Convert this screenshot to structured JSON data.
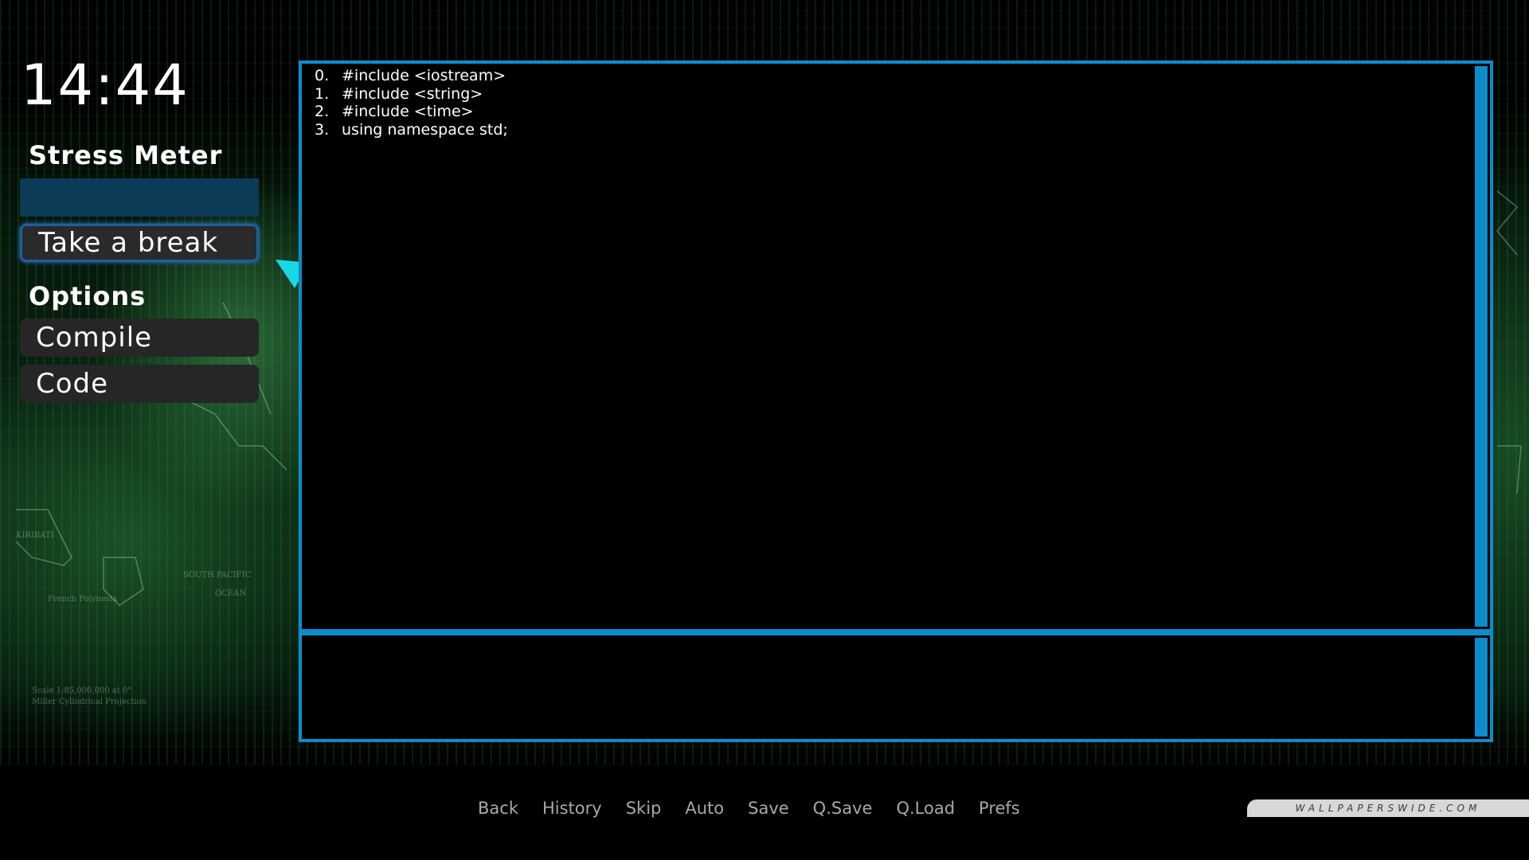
{
  "clock": {
    "time": "14:44"
  },
  "left_panel": {
    "stress_title": "Stress Meter",
    "stress_level": 0,
    "break_button": "Take a break",
    "options_title": "Options",
    "options": [
      "Compile",
      "Code"
    ]
  },
  "editor": {
    "lines": [
      {
        "num": "0.",
        "text": "#include <iostream>"
      },
      {
        "num": "1.",
        "text": "#include <string>"
      },
      {
        "num": "2.",
        "text": "#include <time>"
      },
      {
        "num": "3.",
        "text": "using namespace std;"
      }
    ]
  },
  "quick_menu": [
    "Back",
    "History",
    "Skip",
    "Auto",
    "Save",
    "Q.Save",
    "Q.Load",
    "Prefs"
  ],
  "watermark": "WALLPAPERSWIDE.COM",
  "colors": {
    "accent_blue": "#0c8ccc",
    "stress_bar": "#0b3b57",
    "button_bg": "#262626",
    "arrow": "#18d8e6",
    "quick_menu_text": "#a8a8a8"
  },
  "icons": {
    "arrow": "arrow-pointer-icon"
  }
}
